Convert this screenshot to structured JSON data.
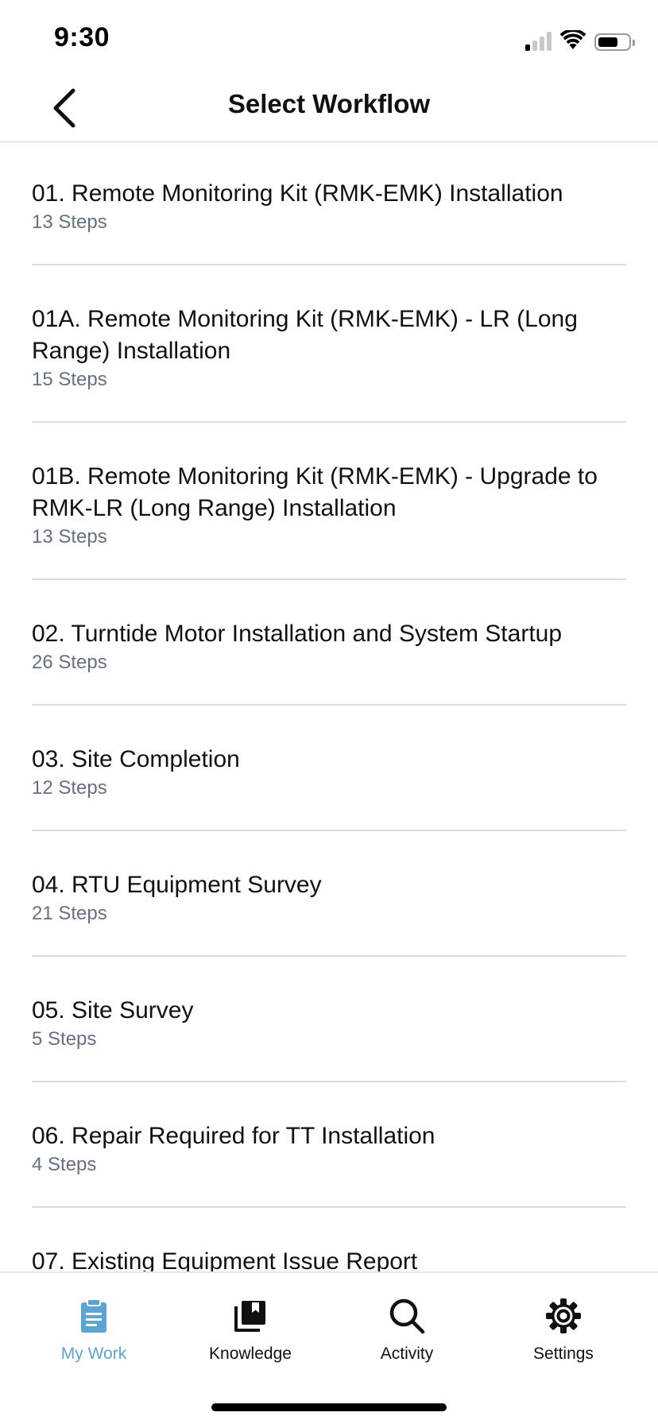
{
  "status_bar": {
    "time": "9:30",
    "icons": [
      "cellular-signal-icon",
      "wifi-icon",
      "battery-icon"
    ]
  },
  "nav": {
    "back_icon": "chevron-left-icon",
    "title": "Select Workflow"
  },
  "workflows": [
    {
      "title": "01. Remote Monitoring Kit (RMK-EMK) Installation",
      "steps": "13 Steps"
    },
    {
      "title": "01A. Remote Monitoring Kit (RMK-EMK) - LR (Long Range) Installation",
      "steps": "15 Steps"
    },
    {
      "title": "01B. Remote Monitoring Kit (RMK-EMK) - Upgrade to RMK-LR (Long Range) Installation",
      "steps": "13 Steps"
    },
    {
      "title": "02. Turntide Motor Installation and System Startup",
      "steps": "26 Steps"
    },
    {
      "title": "03. Site Completion",
      "steps": "12 Steps"
    },
    {
      "title": "04. RTU Equipment Survey",
      "steps": "21 Steps"
    },
    {
      "title": "05. Site Survey",
      "steps": "5 Steps"
    },
    {
      "title": "06. Repair Required for TT Installation",
      "steps": "4 Steps"
    },
    {
      "title": "07. Existing Equipment Issue Report",
      "steps": ""
    }
  ],
  "tabs": [
    {
      "label": "My Work",
      "icon": "clipboard-icon",
      "active": true
    },
    {
      "label": "Knowledge",
      "icon": "book-bookmark-icon",
      "active": false
    },
    {
      "label": "Activity",
      "icon": "search-icon",
      "active": false
    },
    {
      "label": "Settings",
      "icon": "gear-icon",
      "active": false
    }
  ],
  "colors": {
    "accent": "#5ba4d6",
    "secondary_text": "#667085",
    "divider": "#dcdcdf"
  }
}
